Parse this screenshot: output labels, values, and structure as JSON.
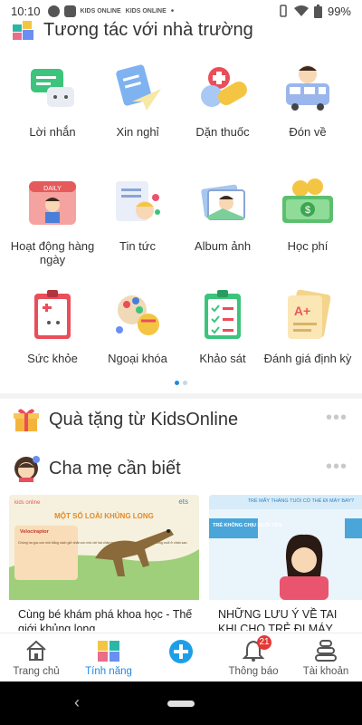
{
  "status": {
    "time": "10:10",
    "battery": "99%",
    "kids_tag_1": "KIDS ONLINE",
    "kids_tag_2": "KIDS ONLINE"
  },
  "section_interact": {
    "title": "Tương tác với nhà trường"
  },
  "features": [
    {
      "label": "Lời nhắn",
      "icon": "message-icon"
    },
    {
      "label": "Xin nghỉ",
      "icon": "leave-request-icon"
    },
    {
      "label": "Dặn thuốc",
      "icon": "medicine-icon"
    },
    {
      "label": "Đón về",
      "icon": "pickup-bus-icon"
    },
    {
      "label": "Hoạt động hàng ngày",
      "icon": "daily-activity-icon"
    },
    {
      "label": "Tin tức",
      "icon": "news-icon"
    },
    {
      "label": "Album ảnh",
      "icon": "photo-album-icon"
    },
    {
      "label": "Học phí",
      "icon": "tuition-icon"
    },
    {
      "label": "Sức khỏe",
      "icon": "health-icon"
    },
    {
      "label": "Ngoại khóa",
      "icon": "extracurricular-icon"
    },
    {
      "label": "Khảo sát",
      "icon": "survey-icon"
    },
    {
      "label": "Đánh giá định kỳ",
      "icon": "periodic-review-icon"
    }
  ],
  "calendar_tag": "DAILY",
  "section_gift": {
    "title": "Quà tặng từ KidsOnline"
  },
  "section_parents": {
    "title": "Cha mẹ cần biết"
  },
  "articles": [
    {
      "title": "Cùng bé khám phá khoa học - Thế giới khủng long",
      "brand": "kids online",
      "brand2": "ets",
      "img_heading": "MỘT SỐ LOÀI KHỦNG LONG",
      "img_sub": "Velociraptor",
      "img_text": "Chúng ha gục con mồi bằng cách giữ chặt con mồi với hai chân trước, rồi xé con mồi bằng bộ móng vuốt ở chân sau"
    },
    {
      "title": "NHỮNG LƯU Ý VỀ TAI KHI CHO TRẺ ĐI MÁY BAY",
      "img_heading": "TRẺ MẤY THÁNG TUỔI CÓ THỂ ĐI MÁY BAY?",
      "img_sub": "TRẺ KHÔNG CHỊU NGỒI YÊN"
    }
  ],
  "bottom_nav": [
    {
      "label": "Trang chủ",
      "icon": "home-icon"
    },
    {
      "label": "Tính năng",
      "icon": "features-icon"
    },
    {
      "label": "",
      "icon": "add-icon"
    },
    {
      "label": "Thông báo",
      "icon": "bell-icon",
      "badge": "21"
    },
    {
      "label": "Tài khoản",
      "icon": "account-icon"
    }
  ],
  "colors": {
    "accent": "#1e88e5",
    "badge": "#e53935"
  }
}
